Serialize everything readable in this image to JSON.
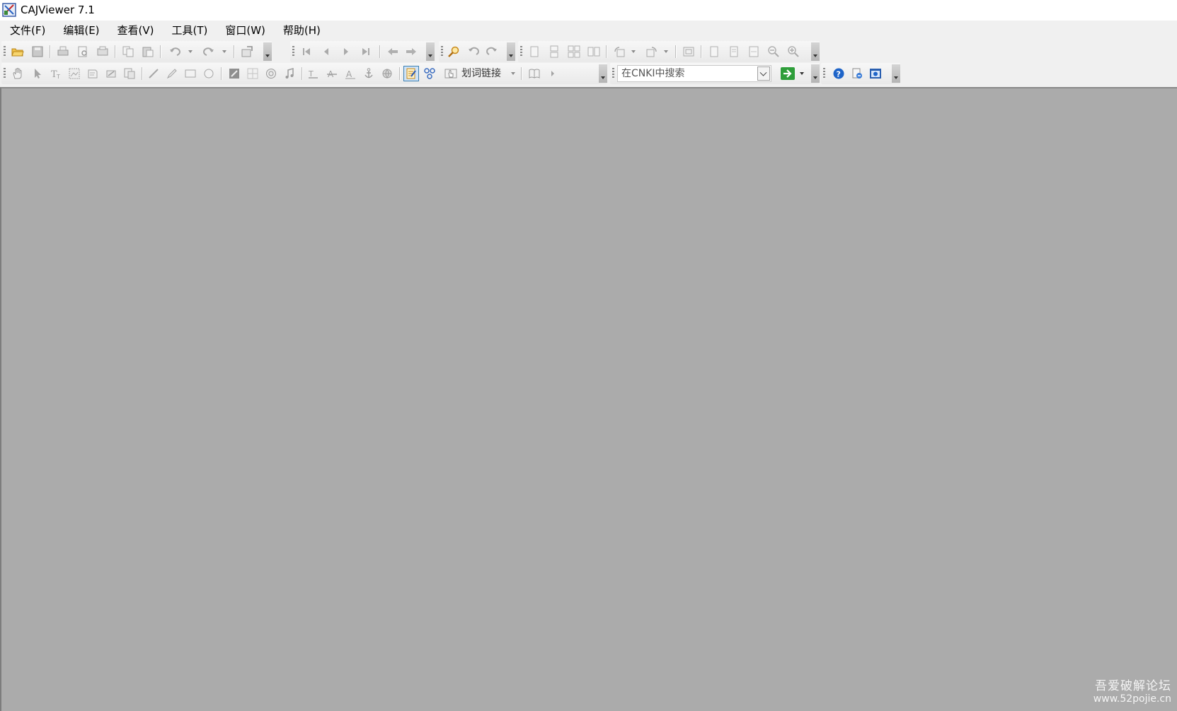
{
  "titlebar": {
    "title": "CAJViewer 7.1",
    "icon": "cajviewer-app-icon"
  },
  "menubar": {
    "items": [
      {
        "label": "文件(F)"
      },
      {
        "label": "编辑(E)"
      },
      {
        "label": "查看(V)"
      },
      {
        "label": "工具(T)"
      },
      {
        "label": "窗口(W)"
      },
      {
        "label": "帮助(H)"
      }
    ]
  },
  "toolbar": {
    "link_mode_label": "划词链接",
    "search_placeholder": "在CNKI中搜索",
    "active_tool": "select-text-tool",
    "colors": {
      "toolbar_bg": "#f0f0f0",
      "workspace_bg": "#ababab",
      "active_border": "#3c7fb1",
      "go_button": "#2e9e3a",
      "help_icon": "#1e64c8"
    }
  },
  "watermark": {
    "line1": "吾爱破解论坛",
    "line2": "www.52pojie.cn"
  }
}
